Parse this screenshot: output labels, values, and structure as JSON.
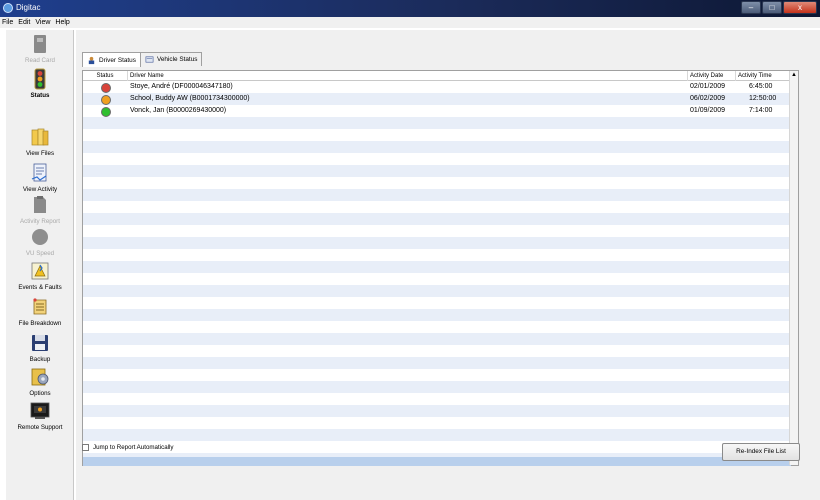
{
  "window": {
    "title": "Digitac",
    "min_glyph": "–",
    "max_glyph": "□",
    "close_glyph": "x"
  },
  "menu": [
    "File",
    "Edit",
    "View",
    "Help"
  ],
  "sidebar": {
    "items": [
      {
        "label": "Read Card",
        "icon": "card-reader-icon",
        "enabled": false
      },
      {
        "label": "Status",
        "icon": "traffic-light-icon",
        "enabled": true,
        "selected": true
      },
      {
        "label": "View Files",
        "icon": "folders-icon",
        "enabled": true
      },
      {
        "label": "View Activity",
        "icon": "activity-document-icon",
        "enabled": true
      },
      {
        "label": "Activity Report",
        "icon": "report-icon",
        "enabled": false
      },
      {
        "label": "VU Speed",
        "icon": "speed-gauge-icon",
        "enabled": false
      },
      {
        "label": "Events & Faults",
        "icon": "events-faults-icon",
        "enabled": true
      },
      {
        "label": "File Breakdown",
        "icon": "file-breakdown-icon",
        "enabled": true
      },
      {
        "label": "Backup",
        "icon": "floppy-disk-icon",
        "enabled": true
      },
      {
        "label": "Options",
        "icon": "options-gear-icon",
        "enabled": true
      },
      {
        "label": "Remote Support",
        "icon": "remote-support-icon",
        "enabled": true
      }
    ]
  },
  "tabs": [
    {
      "label": "Driver Status",
      "icon": "driver-icon",
      "active": true
    },
    {
      "label": "Vehicle Status",
      "icon": "vehicle-icon",
      "active": false
    }
  ],
  "grid": {
    "columns": {
      "status": "Status",
      "driver_name": "Driver Name",
      "activity_date": "Activity Date",
      "activity_time": "Activity Time"
    },
    "rows": [
      {
        "status": "red",
        "driver_name": "Stoye, André (DF000046347180)",
        "activity_date": "02/01/2009",
        "activity_time": "6:45:00"
      },
      {
        "status": "amber",
        "driver_name": "School, Buddy AW (B0001734300000)",
        "activity_date": "06/02/2009",
        "activity_time": "12:50:00"
      },
      {
        "status": "green",
        "driver_name": "Vonck, Jan (B0000269430000)",
        "activity_date": "01/09/2009",
        "activity_time": "7:14:00"
      }
    ],
    "status_colors": {
      "red": "#d9443b",
      "amber": "#f0a020",
      "green": "#2fbf2f"
    },
    "scroll_up": "▲",
    "scroll_down": "▼"
  },
  "options": {
    "jump_to_report_label": "Jump to Report Automatically",
    "jump_to_report_checked": false
  },
  "buttons": {
    "reindex_label": "Re-Index File List"
  },
  "colors": {
    "stripe": "#e8eef8",
    "selected_row": "#b8cfec"
  }
}
